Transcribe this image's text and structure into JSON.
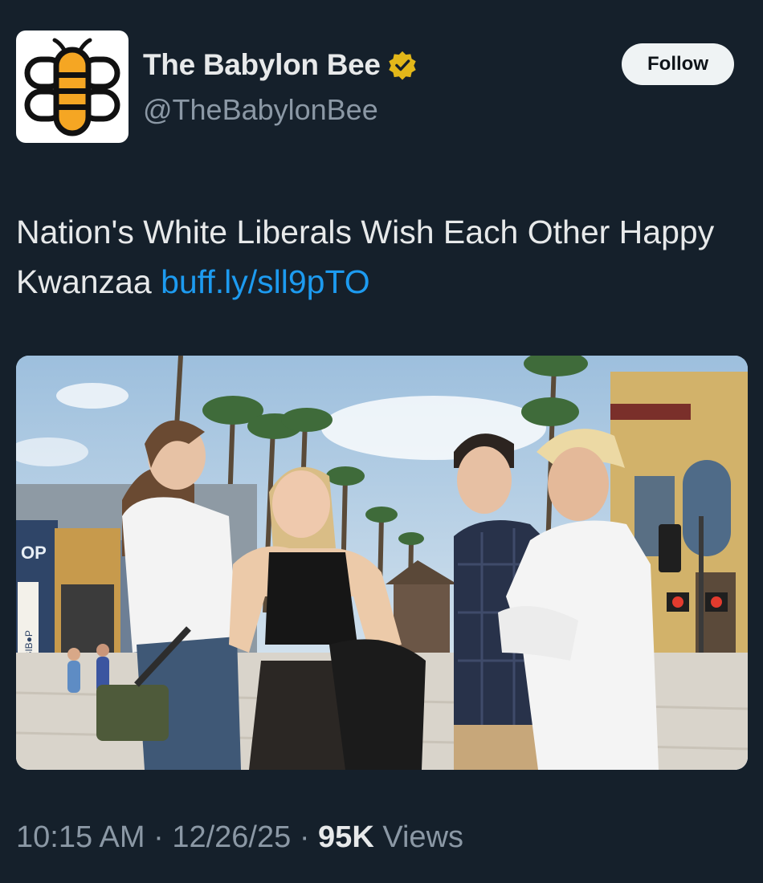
{
  "account": {
    "display_name": "The Babylon Bee",
    "handle": "@TheBabylonBee",
    "verified": true,
    "verified_badge_color": "#e2b719",
    "avatar_icon": "bee-logo-icon",
    "avatar_accent": "#f5a623"
  },
  "follow_button": {
    "label": "Follow"
  },
  "tweet": {
    "text": "Nation's White Liberals Wish Each Other Happy Kwanzaa",
    "link": "buff.ly/sll9pTO",
    "link_color": "#1d9bf0"
  },
  "media": {
    "storefront_sign": "OP",
    "side_sign": "BIBIB●P"
  },
  "meta": {
    "time": "10:15 AM",
    "separator": "·",
    "date": "12/26/25",
    "views_count": "95K",
    "views_label": "Views"
  }
}
